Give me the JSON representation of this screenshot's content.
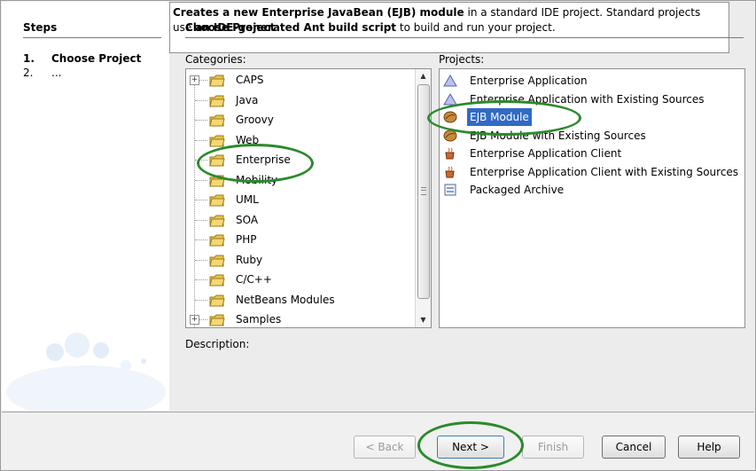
{
  "steps": {
    "heading": "Steps",
    "items": [
      {
        "num": "1.",
        "label": "Choose Project"
      },
      {
        "num": "2.",
        "label": "..."
      }
    ]
  },
  "panel": {
    "title": "Choose Project",
    "categories_label": "Categories:",
    "projects_label": "Projects:",
    "description_label": "Description:"
  },
  "categories": [
    {
      "label": "CAPS"
    },
    {
      "label": "Java"
    },
    {
      "label": "Groovy"
    },
    {
      "label": "Web"
    },
    {
      "label": "Enterprise"
    },
    {
      "label": "Mobility"
    },
    {
      "label": "UML"
    },
    {
      "label": "SOA"
    },
    {
      "label": "PHP"
    },
    {
      "label": "Ruby"
    },
    {
      "label": "C/C++"
    },
    {
      "label": "NetBeans Modules"
    },
    {
      "label": "Samples"
    }
  ],
  "selected_category": "Enterprise",
  "projects": [
    {
      "label": "Enterprise Application",
      "icon": "triangle-icon"
    },
    {
      "label": "Enterprise Application with Existing Sources",
      "icon": "triangle-icon"
    },
    {
      "label": "EJB Module",
      "icon": "bean-icon"
    },
    {
      "label": "EJB Module with Existing Sources",
      "icon": "bean-icon"
    },
    {
      "label": "Enterprise Application Client",
      "icon": "coffee-cup-icon"
    },
    {
      "label": "Enterprise Application Client with Existing Sources",
      "icon": "coffee-cup-icon"
    },
    {
      "label": "Packaged Archive",
      "icon": "archive-icon"
    }
  ],
  "selected_project": "EJB Module",
  "description": {
    "p1_bold": "Creates a new Enterprise JavaBean (EJB) module",
    "p1_rest": " in a standard IDE project. Standard projects use ",
    "p2_bold": "an IDE-generated Ant build script",
    "p2_rest": " to build and run your project."
  },
  "buttons": {
    "back": "< Back",
    "next": "Next >",
    "finish": "Finish",
    "cancel": "Cancel",
    "help": "Help"
  },
  "colors": {
    "selection": "#316ac5",
    "annotation": "#2b8a2b"
  }
}
